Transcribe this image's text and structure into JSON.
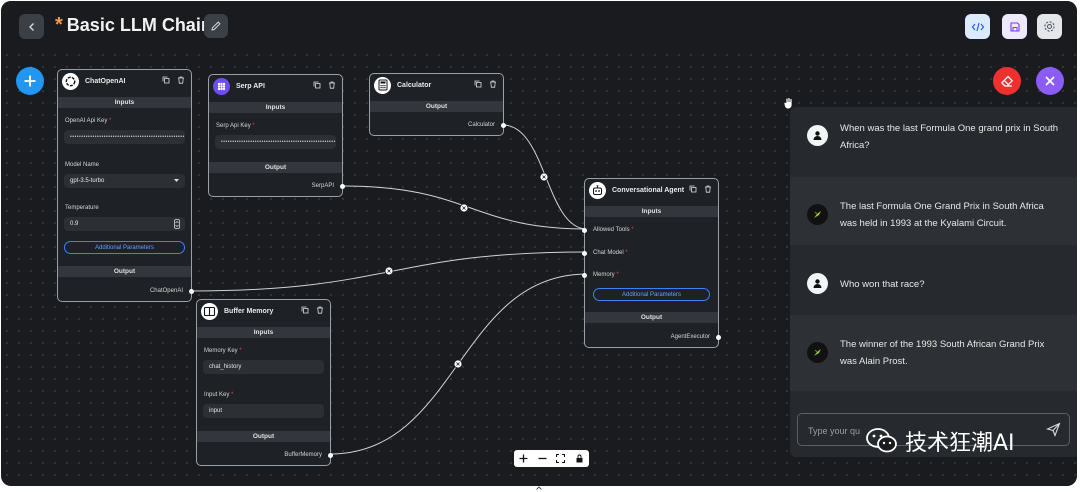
{
  "header": {
    "unsaved_marker": "*",
    "title": "Basic LLM Chain"
  },
  "icons": {
    "back": "chevron-left-icon",
    "edit": "pencil-icon",
    "code": "code-icon",
    "save": "floppy-disk-icon",
    "settings": "gear-icon",
    "add": "plus-icon",
    "clear": "eraser-icon",
    "close": "close-icon",
    "copy": "copy-icon",
    "delete": "trash-icon",
    "send": "send-icon"
  },
  "nodes": {
    "chatopenai": {
      "title": "ChatOpenAI",
      "inputs_label": "Inputs",
      "api_key_label": "OpenAI Api Key",
      "api_key_value": "••••••••••••••••••••••••••••••••••••••••••••••••••••",
      "model_label": "Model Name",
      "model_value": "gpt-3.5-turbo",
      "temperature_label": "Temperature",
      "temperature_value": "0.9",
      "additional_params": "Additional Parameters",
      "output_label": "Output",
      "output_port": "ChatOpenAI"
    },
    "serpapi": {
      "title": "Serp API",
      "inputs_label": "Inputs",
      "api_key_label": "Serp Api Key",
      "api_key_value": "••••••••••••••••••••••••••••••••••••••••••••••••••••",
      "output_label": "Output",
      "output_port": "SerpAPI"
    },
    "calculator": {
      "title": "Calculator",
      "output_label": "Output",
      "output_port": "Calculator"
    },
    "agent": {
      "title": "Conversational Agent",
      "inputs_label": "Inputs",
      "allowed_tools": "Allowed Tools",
      "chat_model": "Chat Model",
      "memory": "Memory",
      "additional_params": "Additional Parameters",
      "output_label": "Output",
      "output_port": "AgentExecutor"
    },
    "buffer_memory": {
      "title": "Buffer Memory",
      "inputs_label": "Inputs",
      "memory_key_label": "Memory Key",
      "memory_key_value": "chat_history",
      "input_key_label": "Input Key",
      "input_key_value": "input",
      "output_label": "Output",
      "output_port": "BufferMemory"
    }
  },
  "chat": {
    "messages": [
      {
        "role": "user",
        "text": "When was the last Formula One grand prix in South Africa?"
      },
      {
        "role": "bot",
        "text": "The last Formula One Grand Prix in South Africa was held in 1993 at the Kyalami Circuit."
      },
      {
        "role": "user",
        "text": "Who won that race?"
      },
      {
        "role": "bot",
        "text": "The winner of the 1993 South African Grand Prix was Alain Prost."
      }
    ],
    "input_placeholder": "Type your qu"
  },
  "watermark": "技术狂潮AI",
  "colors": {
    "canvas": "#1a1b1e",
    "add": "#2196f3",
    "clear": "#f0302f",
    "close": "#8b5cf6",
    "link": "#60a5fa",
    "required": "#ef4444",
    "unsaved": "#f2994a"
  }
}
